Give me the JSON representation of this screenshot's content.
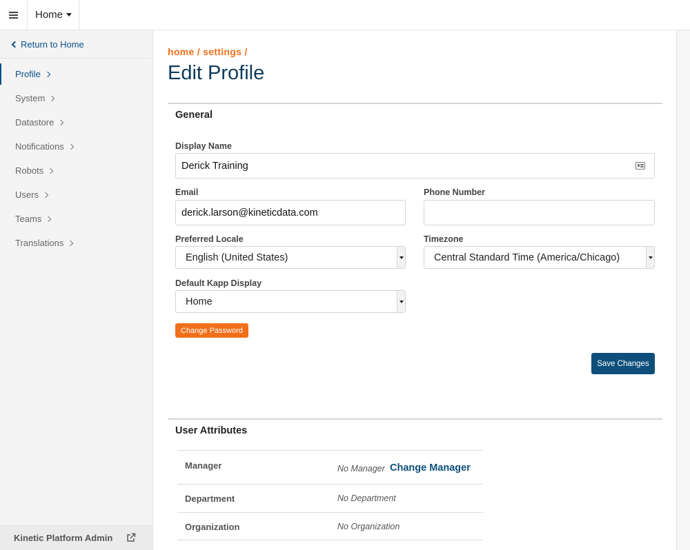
{
  "topbar": {
    "menu_icon": "hamburger-icon",
    "kapp_label": "Home"
  },
  "sidebar": {
    "return_label": "Return to Home",
    "items": [
      {
        "label": "Profile",
        "active": true
      },
      {
        "label": "System"
      },
      {
        "label": "Datastore"
      },
      {
        "label": "Notifications"
      },
      {
        "label": "Robots"
      },
      {
        "label": "Users"
      },
      {
        "label": "Teams"
      },
      {
        "label": "Translations"
      }
    ],
    "footer_label": "Kinetic Platform Admin",
    "footer_icon": "external-link-icon"
  },
  "main": {
    "breadcrumb": {
      "part1": "home",
      "sep1": " / ",
      "part2": "settings",
      "sep2": " /"
    },
    "title": "Edit Profile",
    "general": {
      "title": "General",
      "display_name_label": "Display Name",
      "display_name_value": "Derick Training",
      "email_label": "Email",
      "email_value": "derick.larson@kineticdata.com",
      "phone_label": "Phone Number",
      "phone_value": "",
      "locale_label": "Preferred Locale",
      "locale_value": "English (United States)",
      "timezone_label": "Timezone",
      "timezone_value": "Central Standard Time (America/Chicago)",
      "kapp_display_label": "Default Kapp Display",
      "kapp_display_value": "Home",
      "change_password_label": "Change Password",
      "save_label": "Save Changes"
    },
    "user_attributes": {
      "title": "User Attributes",
      "rows": [
        {
          "key": "Manager",
          "value": "No Manager",
          "action": "Change Manager"
        },
        {
          "key": "Department",
          "value": "No Department"
        },
        {
          "key": "Organization",
          "value": "No Organization"
        }
      ]
    }
  },
  "colors": {
    "accent_orange": "#f26f1a",
    "primary_blue": "#0d4f7a",
    "title_blue": "#0d3a5c"
  }
}
